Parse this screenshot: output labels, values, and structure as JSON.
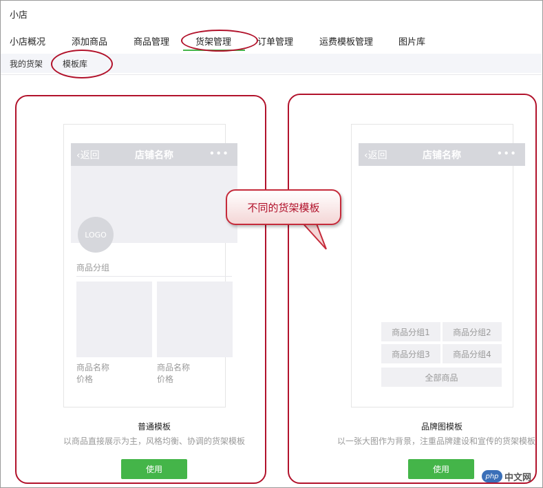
{
  "app": {
    "title": "小店"
  },
  "main_tabs": [
    {
      "label": "小店概况"
    },
    {
      "label": "添加商品"
    },
    {
      "label": "商品管理"
    },
    {
      "label": "货架管理"
    },
    {
      "label": "订单管理"
    },
    {
      "label": "运费模板管理"
    },
    {
      "label": "图片库"
    }
  ],
  "sub_tabs": [
    {
      "label": "我的货架"
    },
    {
      "label": "模板库"
    }
  ],
  "templates": [
    {
      "phone": {
        "back": "返回",
        "title": "店铺名称",
        "more": "•••",
        "logo": "LOGO",
        "category": "商品分组"
      },
      "products": [
        {
          "name": "商品名称",
          "price": "价格"
        },
        {
          "name": "商品名称",
          "price": "价格"
        }
      ],
      "name": "普通模板",
      "desc": "以商品直接展示为主，风格均衡、协调的货架模板",
      "use_label": "使用"
    },
    {
      "phone": {
        "back": "返回",
        "title": "店铺名称",
        "more": "•••"
      },
      "groups": [
        "商品分组1",
        "商品分组2",
        "商品分组3",
        "商品分组4"
      ],
      "all_products": "全部商品",
      "name": "品牌图模板",
      "desc": "以一张大图作为背景，注重品牌建设和宣传的货架模板",
      "use_label": "使用"
    }
  ],
  "callout": {
    "text": "不同的货架模板"
  },
  "watermark": {
    "badge": "php",
    "text": "中文网"
  },
  "colors": {
    "accent": "#44b549",
    "annotation": "#b1112a"
  }
}
